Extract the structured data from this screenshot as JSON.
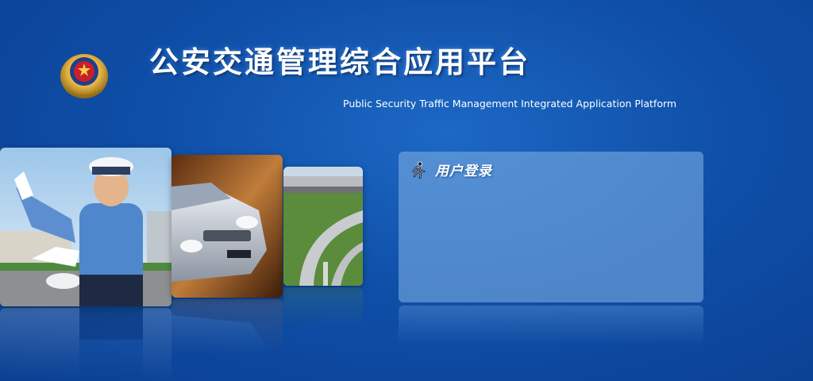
{
  "header": {
    "title": "公安交通管理综合应用平台",
    "subtitle": "Public Security Traffic Management Integrated Application Platform"
  },
  "login": {
    "title": "用户登录"
  },
  "photos": [
    {
      "name": "traffic-police-photo",
      "icon": "traffic-police"
    },
    {
      "name": "car-photo",
      "icon": "car"
    },
    {
      "name": "highway-photo",
      "icon": "highway-interchange"
    }
  ],
  "colors": {
    "background": "#0f4fa8",
    "panel": "#78aae1",
    "text": "#ffffff"
  }
}
